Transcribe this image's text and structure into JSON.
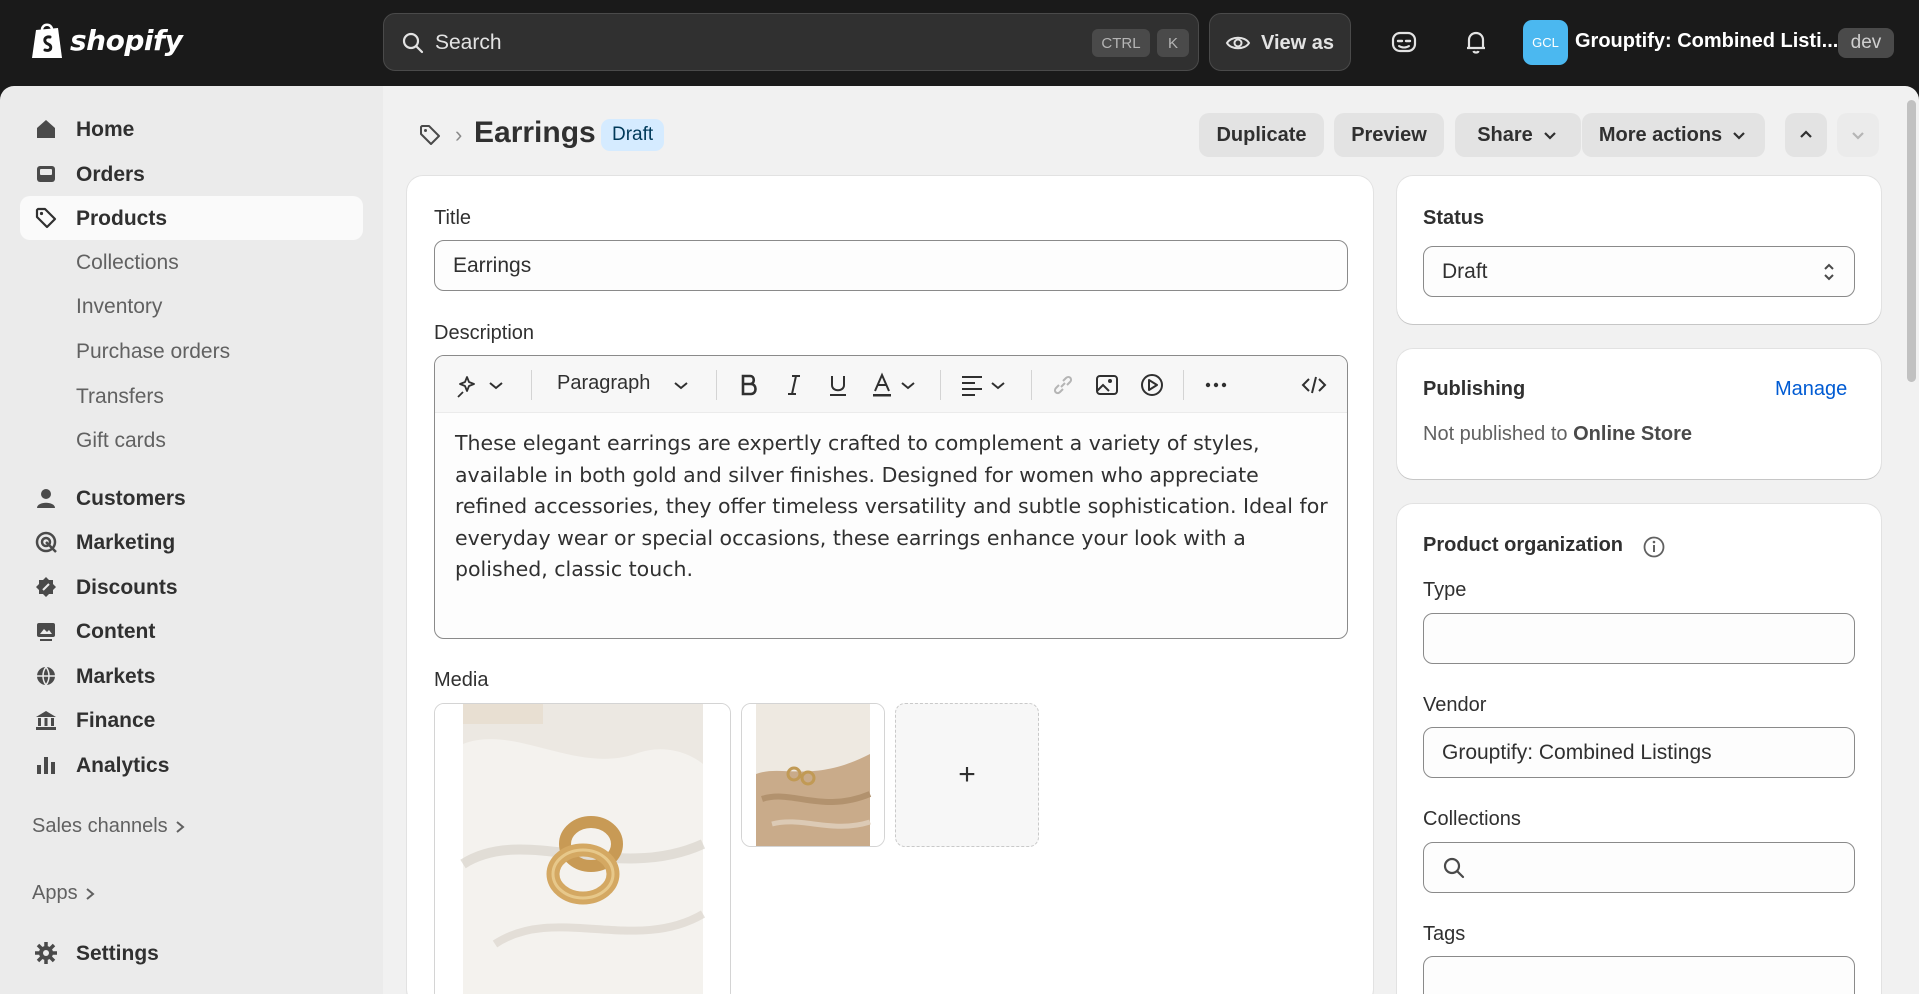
{
  "topbar": {
    "logo_text": "shopify",
    "search_placeholder": "Search",
    "kbd_ctrl": "CTRL",
    "kbd_k": "K",
    "view_as": "View as",
    "store_initials": "GCL",
    "store_name": "Grouptify: Combined Listi...",
    "env_badge": "dev"
  },
  "sidebar": {
    "home": "Home",
    "orders": "Orders",
    "products": "Products",
    "collections": "Collections",
    "inventory": "Inventory",
    "purchase_orders": "Purchase orders",
    "transfers": "Transfers",
    "gift_cards": "Gift cards",
    "customers": "Customers",
    "marketing": "Marketing",
    "discounts": "Discounts",
    "content": "Content",
    "markets": "Markets",
    "finance": "Finance",
    "analytics": "Analytics",
    "sales_channels": "Sales channels",
    "apps": "Apps",
    "settings": "Settings"
  },
  "header": {
    "title": "Earrings",
    "status_badge": "Draft",
    "duplicate": "Duplicate",
    "preview": "Preview",
    "share": "Share",
    "more_actions": "More actions"
  },
  "product": {
    "title_label": "Title",
    "title_value": "Earrings",
    "description_label": "Description",
    "paragraph_format": "Paragraph",
    "description": "These elegant earrings are expertly crafted to complement a variety of styles, available in both gold and silver finishes. Designed for women who appreciate refined accessories, they offer timeless versatility and subtle sophistication. Ideal for everyday wear or special occasions, these earrings enhance your look with a polished, classic touch.",
    "media_label": "Media",
    "add_media": "+"
  },
  "status_card": {
    "label": "Status",
    "value": "Draft"
  },
  "publishing_card": {
    "label": "Publishing",
    "manage": "Manage",
    "not_published_prefix": "Not published to",
    "channel": "Online Store"
  },
  "organization_card": {
    "label": "Product organization",
    "type_label": "Type",
    "type_value": "",
    "vendor_label": "Vendor",
    "vendor_value": "Grouptify: Combined Listings",
    "collections_label": "Collections",
    "tags_label": "Tags"
  },
  "colors": {
    "topbar_bg": "#1a1a1a",
    "draft_badge_bg": "#d5ebff",
    "link_blue": "#005bd3",
    "store_avatar": "#4bb8f0"
  }
}
